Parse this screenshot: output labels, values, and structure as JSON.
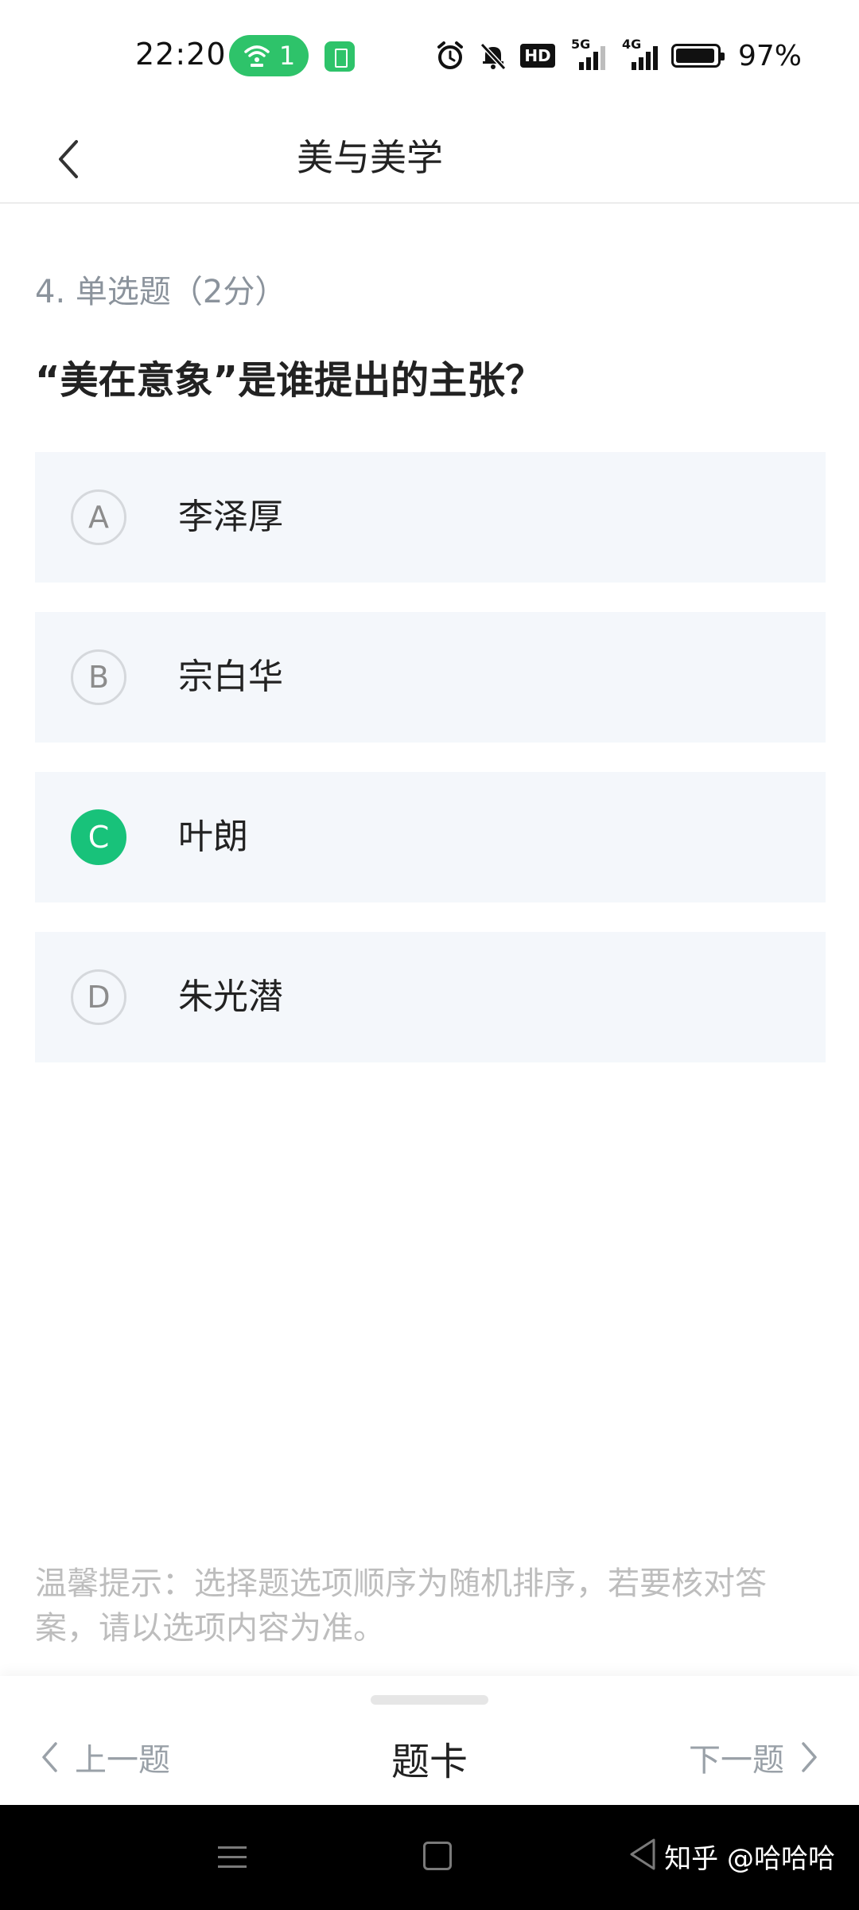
{
  "status_bar": {
    "time": "22:20",
    "hotspot_count": "1",
    "battery_percent": "97%",
    "battery_level": 0.97,
    "network_5g": "5G",
    "network_4g": "4G",
    "hd_label": "HD",
    "hotspot_color": "#2ec36a"
  },
  "header": {
    "title": "美与美学",
    "back_icon": "chevron-left-icon"
  },
  "question": {
    "meta": "4. 单选题（2分）",
    "text": "“美在意象”是谁提出的主张？",
    "options": [
      {
        "letter": "A",
        "text": "李泽厚",
        "selected": false
      },
      {
        "letter": "B",
        "text": "宗白华",
        "selected": false
      },
      {
        "letter": "C",
        "text": "叶朗",
        "selected": true
      },
      {
        "letter": "D",
        "text": "朱光潜",
        "selected": false
      }
    ],
    "selected_color": "#18c27a"
  },
  "tip": {
    "text": "温馨提示：选择题选项顺序为随机排序，若要核对答案，请以选项内容为准。"
  },
  "bottom_nav": {
    "prev_label": "上一题",
    "card_label": "题卡",
    "next_label": "下一题"
  },
  "system_nav": {
    "watermark": "知乎 @哈哈哈"
  }
}
